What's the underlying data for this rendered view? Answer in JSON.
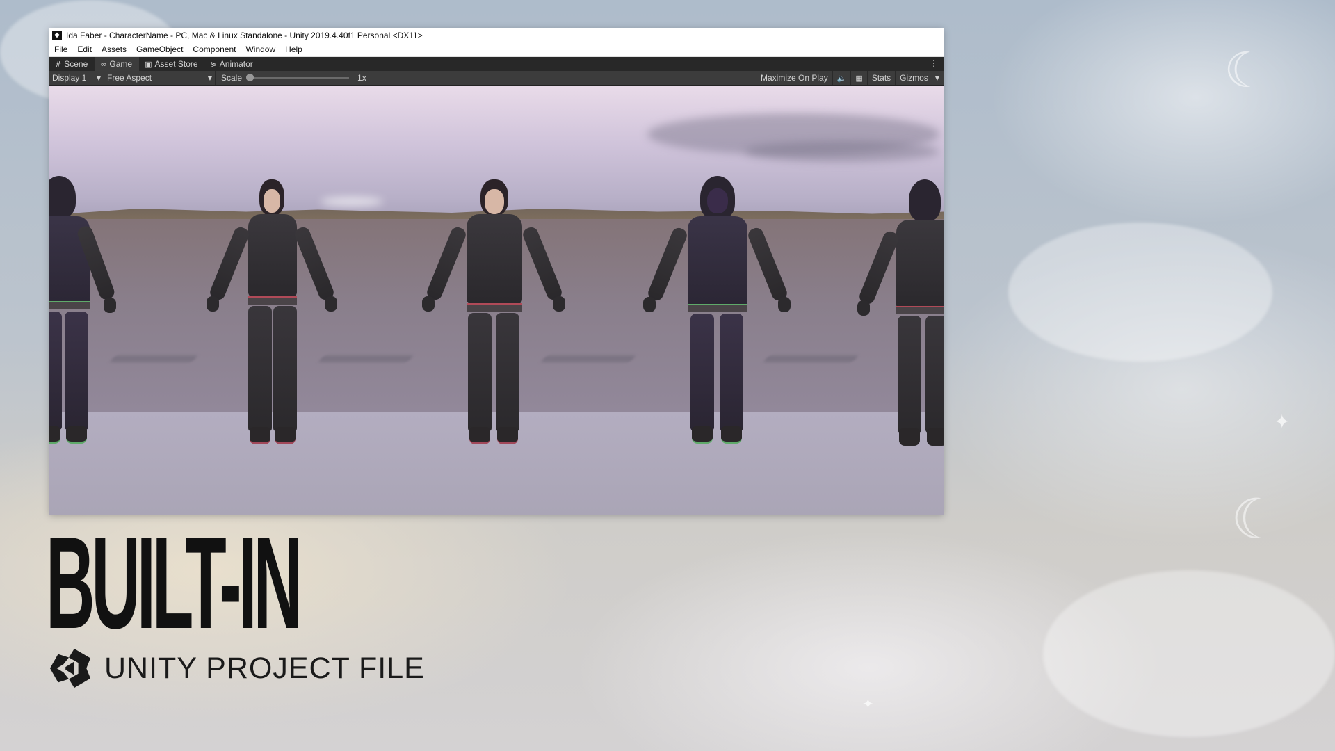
{
  "window": {
    "title": "Ida Faber - CharacterName - PC, Mac & Linux Standalone - Unity 2019.4.40f1 Personal <DX11>"
  },
  "menu": {
    "items": [
      "File",
      "Edit",
      "Assets",
      "GameObject",
      "Component",
      "Window",
      "Help"
    ]
  },
  "tabs": [
    {
      "label": "Scene",
      "icon": "grid-icon",
      "active": false
    },
    {
      "label": "Game",
      "icon": "gamepad-icon",
      "active": true
    },
    {
      "label": "Asset Store",
      "icon": "bag-icon",
      "active": false
    },
    {
      "label": "Animator",
      "icon": "animator-icon",
      "active": false
    }
  ],
  "toolbar": {
    "display": "Display 1",
    "aspect": "Free Aspect",
    "scale_label": "Scale",
    "scale_value": "1x",
    "maximize": "Maximize On Play",
    "stats": "Stats",
    "gizmos": "Gizmos",
    "audio_icon": "speaker-icon",
    "layout_icon": "grid-layout-icon"
  },
  "promo": {
    "headline": "BUILT-IN",
    "subtitle": "UNITY PROJECT FILE"
  },
  "colors": {
    "titlebar": "#ffffff",
    "tabbar": "#282828",
    "toolbar": "#3c3c3c",
    "headline": "#111111"
  }
}
